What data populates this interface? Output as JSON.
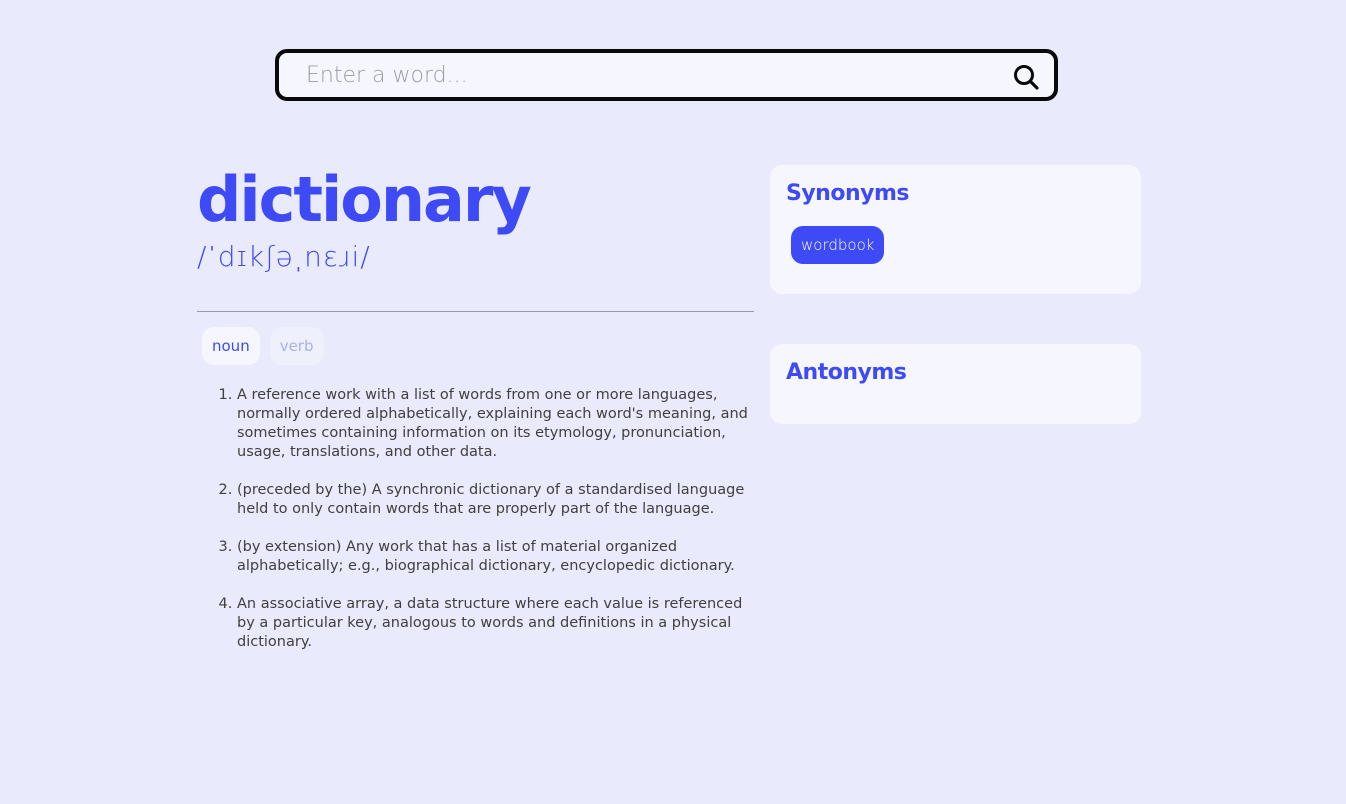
{
  "search": {
    "placeholder": "Enter a word...",
    "value": "",
    "icon": "search-icon"
  },
  "entry": {
    "word": "dictionary",
    "phonetic": "/ˈdɪkʃəˌnɛɹi/"
  },
  "parts_of_speech": [
    {
      "label": "noun",
      "active": true
    },
    {
      "label": "verb",
      "active": false
    }
  ],
  "definitions": [
    "A reference work with a list of words from one or more languages, normally ordered alphabetically, explaining each word's meaning, and sometimes containing information on its etymology, pronunciation, usage, translations, and other data.",
    "(preceded by the) A synchronic dictionary of a standardised language held to only contain words that are properly part of the language.",
    "(by extension) Any work that has a list of material organized alphabetically; e.g., biographical dictionary, encyclopedic dictionary.",
    "An associative array, a data structure where each value is referenced by a particular key, analogous to words and definitions in a physical dictionary."
  ],
  "synonyms": {
    "title": "Synonyms",
    "items": [
      "wordbook"
    ]
  },
  "antonyms": {
    "title": "Antonyms",
    "items": []
  },
  "colors": {
    "accent": "#3d4af5",
    "background": "#e9eafb",
    "card": "#f6f7fe"
  }
}
